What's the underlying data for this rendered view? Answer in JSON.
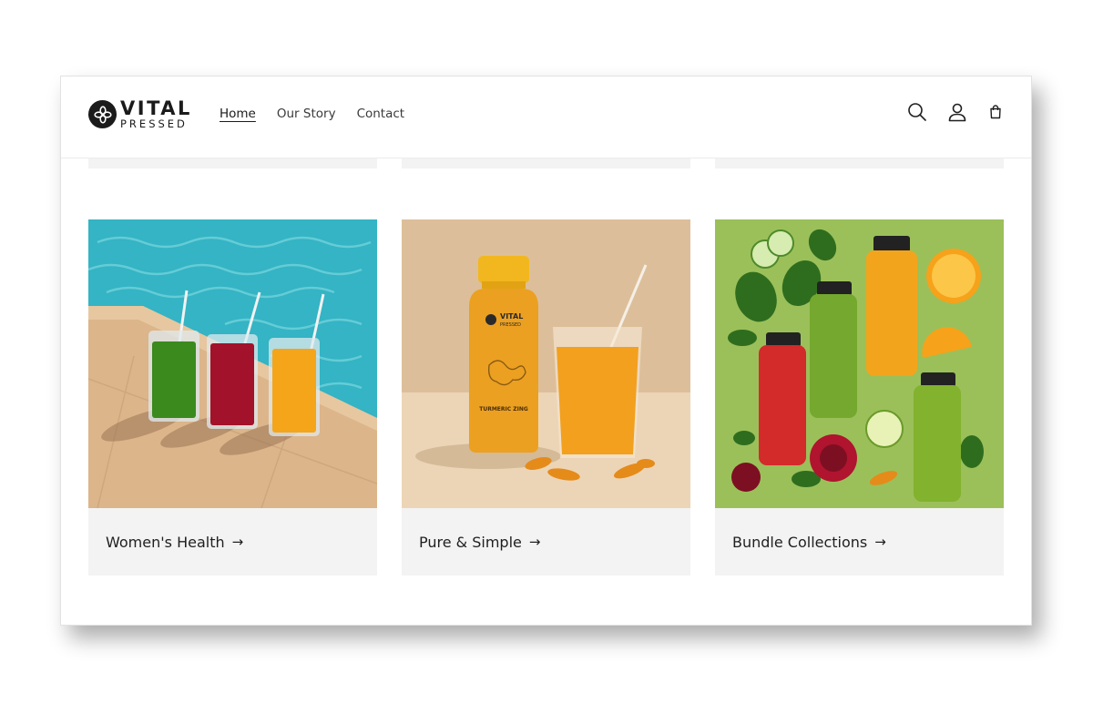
{
  "brand": {
    "name_top": "VITAL",
    "name_bottom": "PRESSED"
  },
  "nav": {
    "items": [
      {
        "label": "Home",
        "active": true
      },
      {
        "label": "Our Story",
        "active": false
      },
      {
        "label": "Contact",
        "active": false
      }
    ]
  },
  "header_icons": [
    "search-icon",
    "account-icon",
    "cart-icon"
  ],
  "collections": [
    {
      "title": "Women's Health",
      "arrow": "→"
    },
    {
      "title": "Pure & Simple",
      "arrow": "→"
    },
    {
      "title": "Bundle Collections",
      "arrow": "→"
    }
  ],
  "product_labels": {
    "bottle_brand_top": "VITAL",
    "bottle_brand_bottom": "PRESSED",
    "bottle_flavor": "TURMERIC ZING"
  },
  "colors": {
    "card_footer_bg": "#f3f3f3",
    "text_dark": "#1b1b1b",
    "pool_water": "#34b4c4",
    "juice_green": "#3a8a1e",
    "juice_red": "#a2122a",
    "juice_orange": "#f5a51a",
    "bundle_bg": "#9bc05a"
  }
}
